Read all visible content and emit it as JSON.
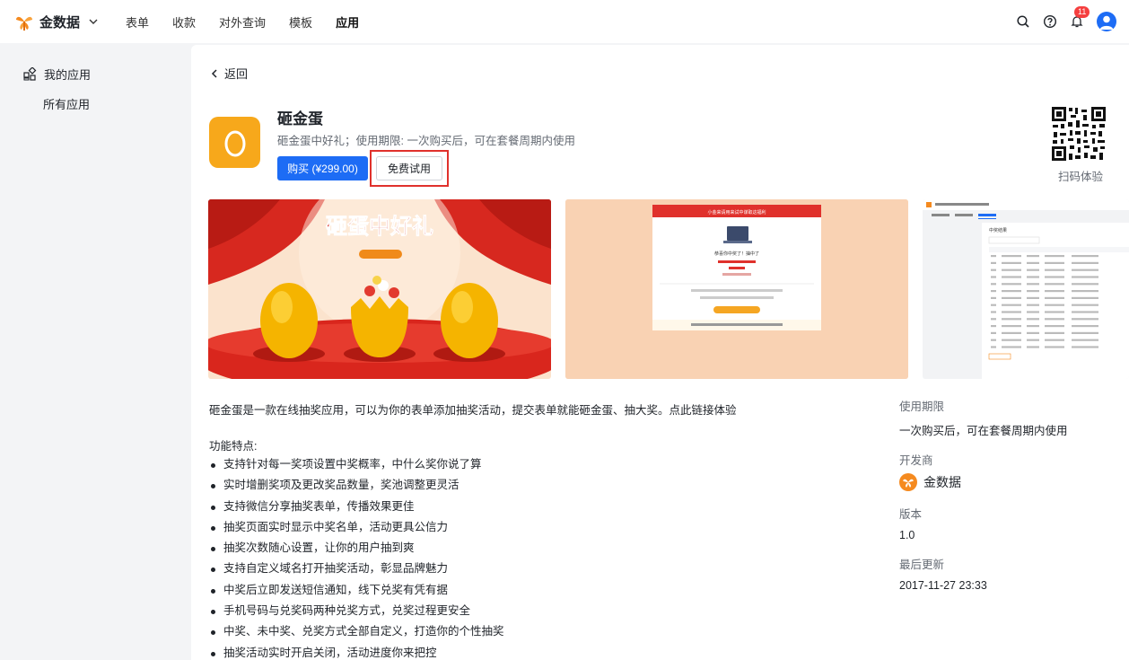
{
  "brand": {
    "name": "金数据"
  },
  "nav": [
    {
      "label": "表单",
      "active": false
    },
    {
      "label": "收款",
      "active": false
    },
    {
      "label": "对外查询",
      "active": false
    },
    {
      "label": "模板",
      "active": false
    },
    {
      "label": "应用",
      "active": true
    }
  ],
  "header": {
    "notification_count": "11"
  },
  "sidebar": {
    "my_apps": "我的应用",
    "all_apps": "所有应用"
  },
  "main": {
    "back_label": "返回"
  },
  "app": {
    "title": "砸金蛋",
    "description": "砸金蛋中好礼；使用期限: 一次购买后，可在套餐周期内使用",
    "buy_label": "购买 (¥299.00)",
    "trial_label": "免费试用",
    "qr_label": "扫码体验",
    "intro": "砸金蛋是一款在线抽奖应用，可以为你的表单添加抽奖活动，提交表单就能砸金蛋、抽大奖。点此链接体验",
    "features_title": "功能特点:",
    "features": [
      "支持针对每一奖项设置中奖概率，中什么奖你说了算",
      "实时增删奖项及更改奖品数量，奖池调整更灵活",
      "支持微信分享抽奖表单，传播效果更佳",
      "抽奖页面实时显示中奖名单，活动更具公信力",
      "抽奖次数随心设置，让你的用户抽到爽",
      "支持自定义域名打开抽奖活动，彰显品牌魅力",
      "中奖后立即发送短信通知，线下兑奖有凭有据",
      "手机号码与兑奖码两种兑奖方式，兑奖过程更安全",
      "中奖、未中奖、兑奖方式全部自定义，打造你的个性抽奖",
      "抽奖活动实时开启关闭，活动进度你来把控"
    ]
  },
  "meta": {
    "usage_label": "使用期限",
    "usage_value": "一次购买后，可在套餐周期内使用",
    "developer_label": "开发商",
    "developer_name": "金数据",
    "version_label": "版本",
    "version_value": "1.0",
    "updated_label": "最后更新",
    "updated_value": "2017-11-27 23:33"
  },
  "screenshots": {
    "banner_text": "砸蛋中好礼",
    "modal_title": "小金来请用来试中谋取这福利",
    "modal_text": "恭喜你中奖了！抽中了",
    "table_title": "中奖结果"
  },
  "colors": {
    "accent": "#1d6cf5",
    "highlight": "#e0312c",
    "app_icon": "#f7a81b",
    "brand_orange": "#f58a1f"
  }
}
